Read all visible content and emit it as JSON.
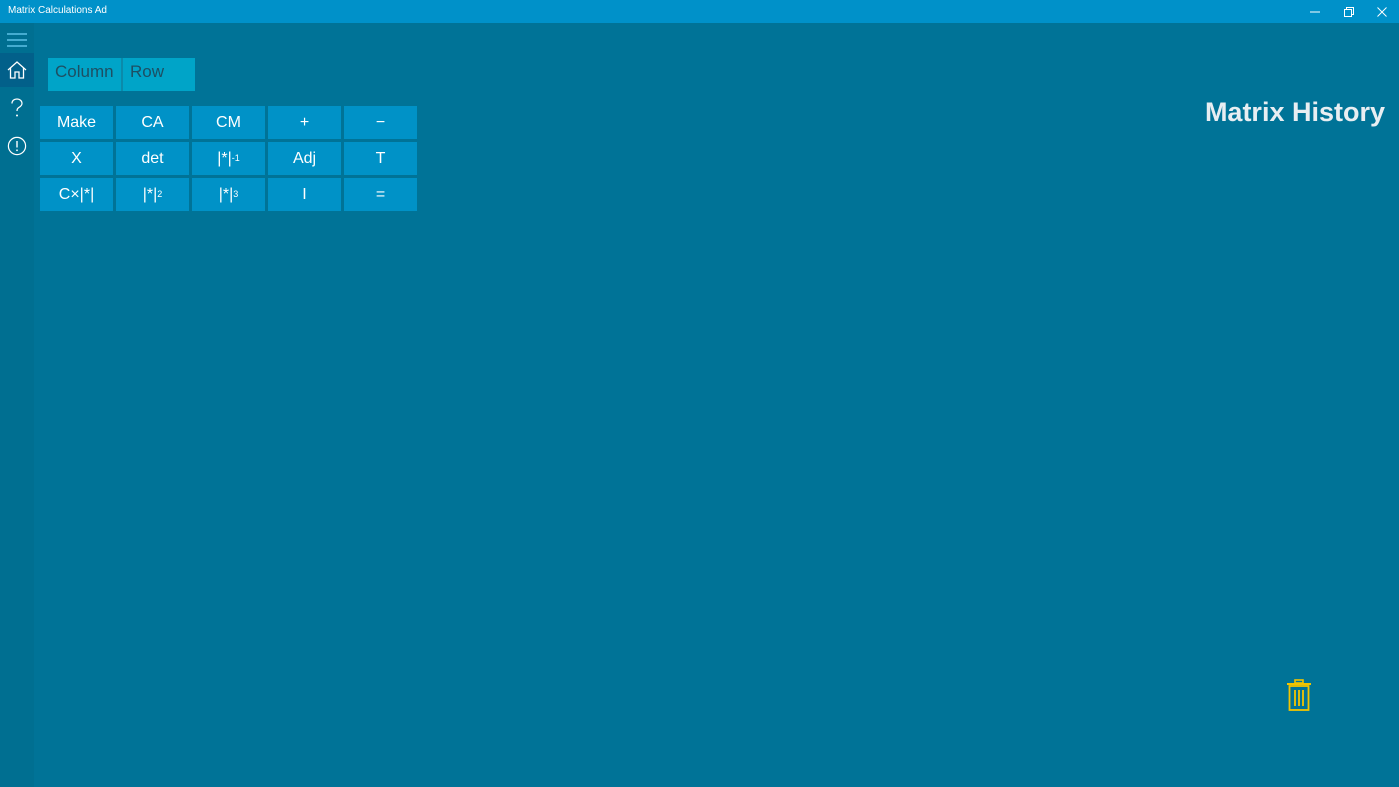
{
  "window": {
    "title": "Matrix Calculations Ad",
    "controls": {
      "minimize_icon": "minimize-icon",
      "maximize_icon": "restore-icon",
      "close_icon": "close-icon"
    }
  },
  "nav": {
    "items": [
      {
        "icon": "hamburger-icon"
      },
      {
        "icon": "home-icon",
        "selected": true
      },
      {
        "icon": "question-icon"
      },
      {
        "icon": "info-icon"
      }
    ]
  },
  "segments": {
    "column_label": "Column",
    "row_label": "Row"
  },
  "keypad": {
    "rows": [
      [
        "Make",
        "CA",
        "CM",
        "+",
        "−"
      ],
      [
        "X",
        "det",
        "|*|",
        "Adj",
        "T"
      ],
      [
        "C×|*|",
        "|*|",
        "|*|",
        "I",
        "="
      ]
    ],
    "superscripts": {
      "inverse": "-1",
      "square": "2",
      "cube": "3"
    }
  },
  "history": {
    "title": "Matrix History",
    "delete_icon": "trash-icon"
  },
  "colors": {
    "background": "#007397",
    "titlebar": "#0091c9",
    "nav_rail": "#006f91",
    "key": "#0092c7",
    "segment": "#00a4c8",
    "trash": "#f2c400"
  }
}
